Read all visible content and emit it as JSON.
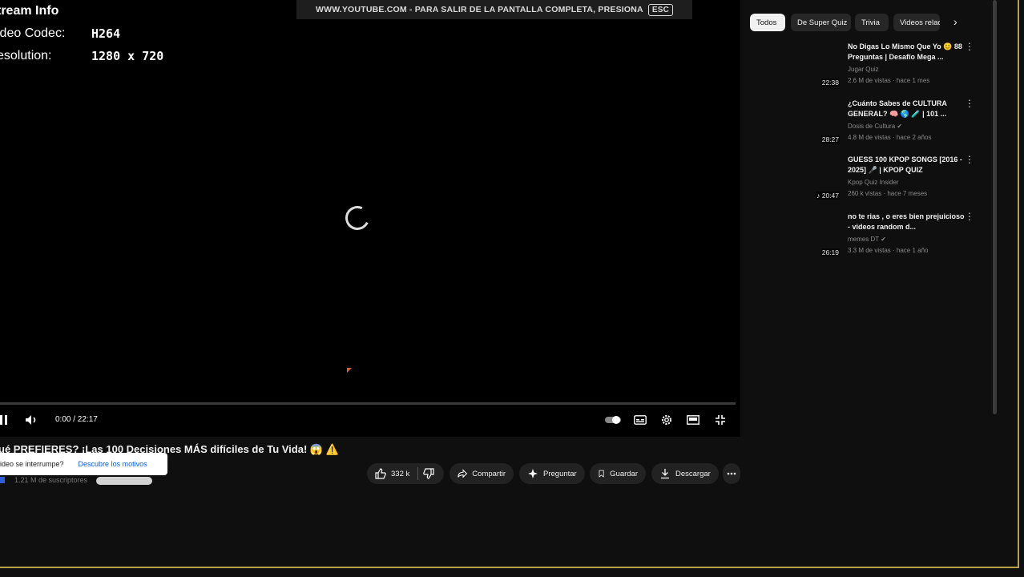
{
  "stats": {
    "heading": "tream Info",
    "codec_label": "ideo Codec:",
    "codec_value": "H264",
    "res_label": "esolution:",
    "res_value": "1280 x 720"
  },
  "fullscreen_banner": {
    "text": "WWW.YOUTUBE.COM - PARA SALIR DE LA PANTALLA COMPLETA, PRESIONA",
    "key": "ESC"
  },
  "player": {
    "time": "0:00 / 22:17",
    "progress_fraction": 0
  },
  "video": {
    "title": "ué PREFIERES? ¡Las 100 Decisiones MÁS difíciles de Tu Vida! 😱 ⚠️",
    "subscribers": "1.21 M de suscriptores"
  },
  "tooltip": {
    "question": "ideo se interrumpe?",
    "link": "Descubre los motivos"
  },
  "actions": {
    "likes": "332 k",
    "share": "Compartir",
    "ask": "Preguntar",
    "save": "Guardar",
    "download": "Descargar"
  },
  "chips": [
    "Todos",
    "De Super Quiz",
    "Trivia",
    "Videos relac"
  ],
  "recommendations": [
    {
      "title": "No Digas Lo Mismo Que Yo 😊 88 Preguntas | Desafío Mega ...",
      "channel": "Jugar Quiz",
      "meta": "2.6 M de vistas · hace 1 mes",
      "duration": "22:38"
    },
    {
      "title": "¿Cuánto Sabes de CULTURA GENERAL? 🧠 🌎 🧪 | 101 ...",
      "channel": "Dosis de Cultura ✔",
      "meta": "4.8 M de vistas · hace 2 años",
      "duration": "28:27"
    },
    {
      "title": "GUESS 100 KPOP SONGS [2016 - 2025] 🎤 | KPOP QUIZ",
      "channel": "Kpop Quiz Insider",
      "meta": "260 k vistas · hace 7 meses",
      "duration": "♪ 20:47"
    },
    {
      "title": "no te rias , o eres bien prejuicioso - videos random d...",
      "channel": "memes DT ✔",
      "meta": "3.3 M de vistas · hace 1 año",
      "duration": "26:19"
    }
  ]
}
